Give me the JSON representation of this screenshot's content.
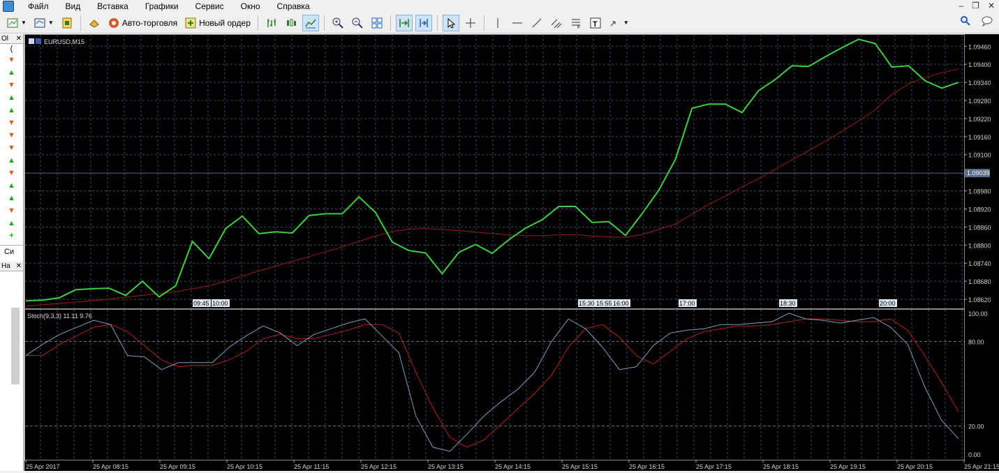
{
  "menu": {
    "items": [
      "Файл",
      "Вид",
      "Вставка",
      "Графики",
      "Сервис",
      "Окно",
      "Справка"
    ]
  },
  "toolbar": {
    "auto_trading_label": "Авто-торговля",
    "new_order_label": "Новый ордер"
  },
  "left_panel": {
    "market_watch_tab": "Ol",
    "navigator_tab": "На",
    "symbols_tab_label": "Си",
    "row_directions": [
      "down",
      "up",
      "down",
      "up",
      "up",
      "down",
      "down",
      "down",
      "up",
      "down",
      "up",
      "up",
      "down",
      "up"
    ],
    "add_icon": "plus-icon"
  },
  "chart": {
    "symbol_label": "EURUSD,M15",
    "indicator_label": "Stoch(9,3,3) 11.11 9.76",
    "current_price_label": "1.09039",
    "colors": {
      "background": "#000000",
      "grid": "#3a4a66",
      "price": "#3fce3f",
      "ma": "#9c1a1a",
      "stoch_main": "#7e9fba",
      "stoch_signal": "#b22222",
      "axis_text": "#d0d0d0"
    },
    "price_axis_labels": [
      "1.09460",
      "1.09400",
      "1.09340",
      "1.09280",
      "1.09220",
      "1.09160",
      "1.09100",
      "1.08980",
      "1.08920",
      "1.08860",
      "1.08800",
      "1.08740",
      "1.08680",
      "1.08620"
    ],
    "stoch_axis_labels": [
      "100.00",
      "80.00",
      "20.00",
      "0.00"
    ],
    "time_axis_labels": [
      "25 Apr 2017",
      "25 Apr 08:15",
      "25 Apr 09:15",
      "25 Apr 10:15",
      "25 Apr 11:15",
      "25 Apr 12:15",
      "25 Apr 13:15",
      "25 Apr 14:15",
      "25 Apr 15:15",
      "25 Apr 16:15",
      "25 Apr 17:15",
      "25 Apr 18:15",
      "25 Apr 19:15",
      "25 Apr 20:15",
      "25 Apr 21:15"
    ],
    "event_tags": [
      "09:45",
      "10:00",
      "15:30",
      "15:55",
      "16:00",
      "17:00",
      "18:30",
      "20:00"
    ]
  },
  "chart_data": [
    {
      "type": "line",
      "title": "EURUSD,M15",
      "ylim": [
        1.0859,
        1.095
      ],
      "series": [
        {
          "name": "EURUSD,M15",
          "values": [
            1.08615,
            1.08617,
            1.08625,
            1.08652,
            1.08655,
            1.08657,
            1.08633,
            1.0868,
            1.08628,
            1.08665,
            1.08812,
            1.08755,
            1.08855,
            1.08896,
            1.08838,
            1.08844,
            1.0884,
            1.08898,
            1.08904,
            1.08904,
            1.0896,
            1.08908,
            1.0881,
            1.08782,
            1.08774,
            1.08705,
            1.08776,
            1.08802,
            1.08773,
            1.08818,
            1.08856,
            1.08884,
            1.08928,
            1.08928,
            1.08875,
            1.08878,
            1.08832,
            1.08904,
            1.08982,
            1.09084,
            1.09254,
            1.09268,
            1.09268,
            1.0924,
            1.09313,
            1.0935,
            1.09395,
            1.09393,
            1.09425,
            1.09455,
            1.09483,
            1.09469,
            1.09391,
            1.09395,
            1.09345,
            1.09321,
            1.0934
          ]
        },
        {
          "name": "MA",
          "values": [
            1.08597,
            1.08602,
            1.08606,
            1.08611,
            1.08615,
            1.08621,
            1.08627,
            1.08633,
            1.08639,
            1.08645,
            1.08655,
            1.08665,
            1.0868,
            1.08697,
            1.08714,
            1.0873,
            1.08746,
            1.08762,
            1.08778,
            1.08794,
            1.08812,
            1.0883,
            1.08845,
            1.08853,
            1.08855,
            1.08852,
            1.08848,
            1.08843,
            1.08838,
            1.08834,
            1.08831,
            1.08831,
            1.08834,
            1.08835,
            1.0883,
            1.08827,
            1.08826,
            1.08835,
            1.08852,
            1.0887,
            1.08902,
            1.08935,
            1.08963,
            1.08993,
            1.09021,
            1.09052,
            1.09083,
            1.09113,
            1.09145,
            1.09178,
            1.09212,
            1.0925,
            1.093,
            1.09335,
            1.09357,
            1.09372,
            1.09385
          ]
        }
      ]
    },
    {
      "type": "line",
      "title": "Stoch(9,3,3) 11.11 9.76",
      "ylim": [
        0,
        100
      ],
      "series": [
        {
          "name": "Main",
          "values": [
            70,
            78,
            85,
            90,
            95,
            92,
            70,
            69,
            60,
            65,
            65,
            65,
            76,
            84,
            91,
            86,
            77,
            85,
            89,
            93,
            96,
            84,
            72,
            27,
            5,
            2,
            14,
            27,
            37,
            46,
            58,
            80,
            96,
            89,
            76,
            60,
            62,
            77,
            86,
            88,
            89,
            92,
            92,
            93,
            94,
            100,
            96,
            95,
            93,
            95,
            97,
            90,
            78,
            48,
            24,
            11
          ]
        },
        {
          "name": "Signal",
          "values": [
            70,
            70,
            78,
            84,
            90,
            92,
            87,
            77,
            67,
            62,
            63,
            63,
            67,
            73,
            82,
            85,
            82,
            82,
            85,
            88,
            92,
            92,
            86,
            58,
            33,
            12,
            5,
            10,
            21,
            32,
            43,
            56,
            76,
            89,
            92,
            83,
            70,
            64,
            73,
            82,
            87,
            89,
            91,
            91,
            92,
            94,
            96,
            96,
            95,
            94,
            94,
            96,
            88,
            70,
            51,
            30
          ]
        }
      ]
    }
  ]
}
